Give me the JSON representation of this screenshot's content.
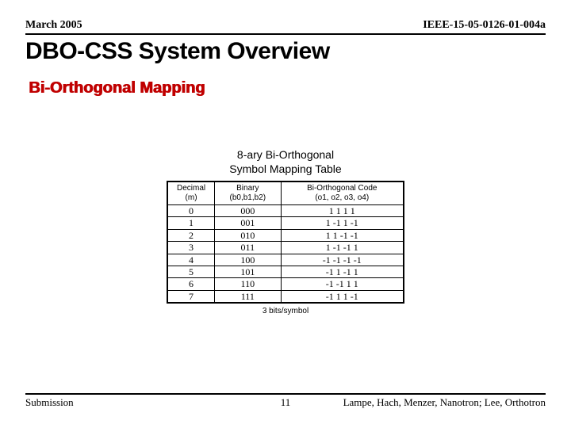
{
  "header": {
    "date": "March 2005",
    "docnum": "IEEE-15-05-0126-01-004a"
  },
  "title": "DBO-CSS System Overview",
  "section": "Bi-Orthogonal Mapping",
  "table": {
    "caption_line1": "8-ary Bi-Orthogonal",
    "caption_line2": "Symbol Mapping Table",
    "headers": {
      "dec_label": "Decimal",
      "dec_sub": "(m)",
      "bin_label": "Binary",
      "bin_sub": "(b0,b1,b2)",
      "code_label": "Bi-Orthogonal Code",
      "code_sub": "(o1, o2, o3, o4)"
    },
    "rows": [
      {
        "dec": "0",
        "bin": "000",
        "code": "1  1  1  1"
      },
      {
        "dec": "1",
        "bin": "001",
        "code": "1 -1  1 -1"
      },
      {
        "dec": "2",
        "bin": "010",
        "code": "1  1 -1 -1"
      },
      {
        "dec": "3",
        "bin": "011",
        "code": "1 -1 -1  1"
      },
      {
        "dec": "4",
        "bin": "100",
        "code": "-1 -1 -1 -1"
      },
      {
        "dec": "5",
        "bin": "101",
        "code": "-1  1 -1  1"
      },
      {
        "dec": "6",
        "bin": "110",
        "code": "-1 -1  1  1"
      },
      {
        "dec": "7",
        "bin": "111",
        "code": "-1  1  1 -1"
      }
    ],
    "note": "3 bits/symbol"
  },
  "footer": {
    "left": "Submission",
    "center": "11",
    "right": "Lampe, Hach, Menzer, Nanotron; Lee, Orthotron"
  }
}
